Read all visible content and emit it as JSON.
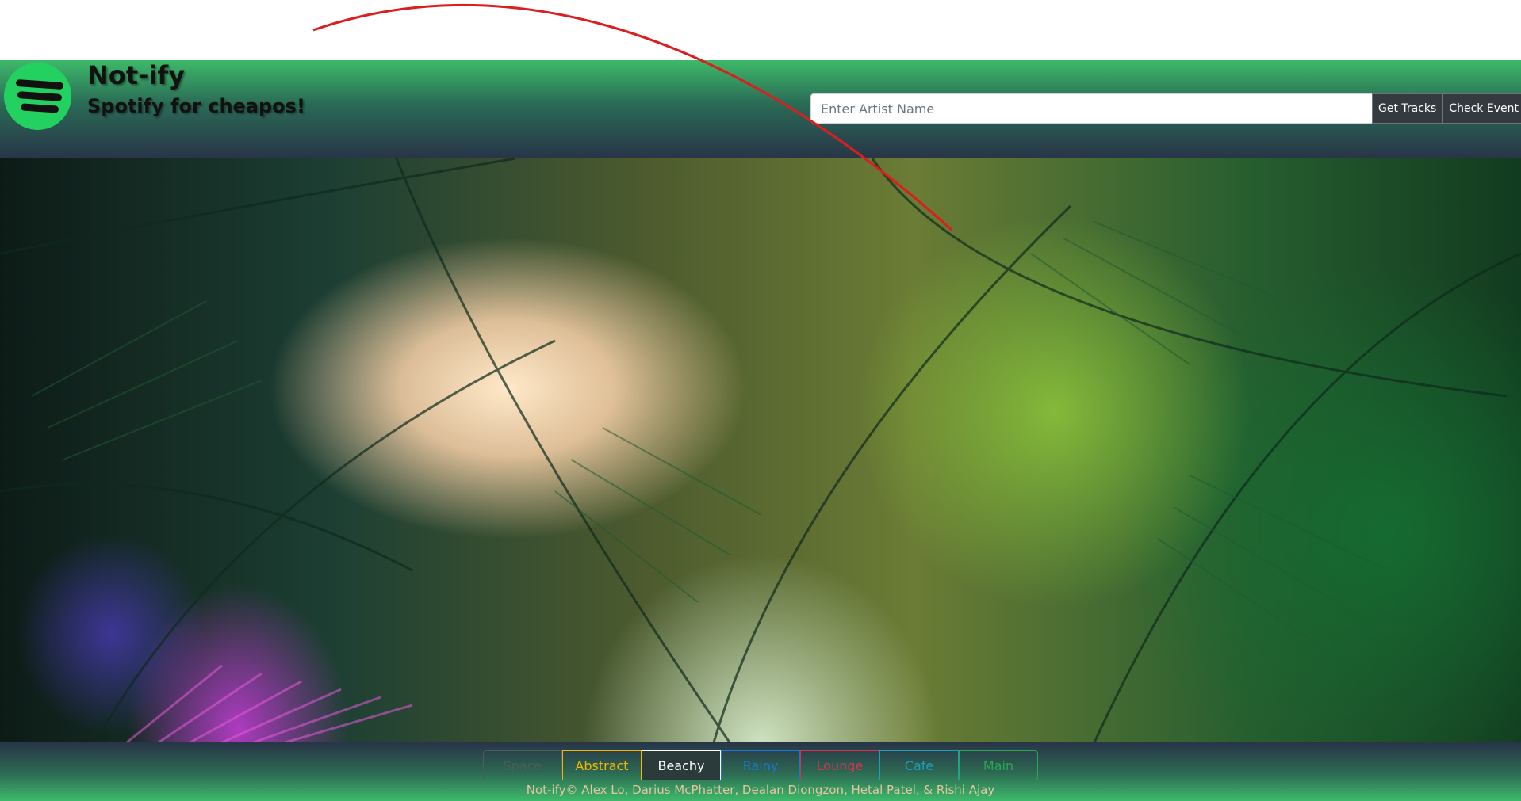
{
  "header": {
    "title": "Not-ify",
    "subtitle": "Spotify for cheapos!",
    "logo_icon": "spotify-logo-icon"
  },
  "search": {
    "placeholder": "Enter Artist Name",
    "value": "",
    "get_tracks_label": "Get Tracks",
    "check_event_label": "Check Event"
  },
  "hero": {
    "image": "tropical-palm-fronds-background"
  },
  "footer": {
    "themes": [
      {
        "label": "Space",
        "color": "#4a5e5a",
        "active": false
      },
      {
        "label": "Abstract",
        "color": "#f5b800",
        "active": false
      },
      {
        "label": "Beachy",
        "color": "#ffffff",
        "active": true
      },
      {
        "label": "Rainy",
        "color": "#1877d8",
        "active": false
      },
      {
        "label": "Lounge",
        "color": "#d8334a",
        "active": false
      },
      {
        "label": "Cafe",
        "color": "#1aa0b8",
        "active": false
      },
      {
        "label": "Main",
        "color": "#2aa84f",
        "active": false
      }
    ],
    "credit": "Not-ify© Alex Lo, Darius McPhatter, Dealan Diongzon, Hetal Patel, & Rishi Ajay"
  },
  "colors": {
    "header_green": "#3dba6a",
    "header_dark": "#283548",
    "logo_green": "#23d160",
    "annotation_red": "#dc1e1e"
  }
}
